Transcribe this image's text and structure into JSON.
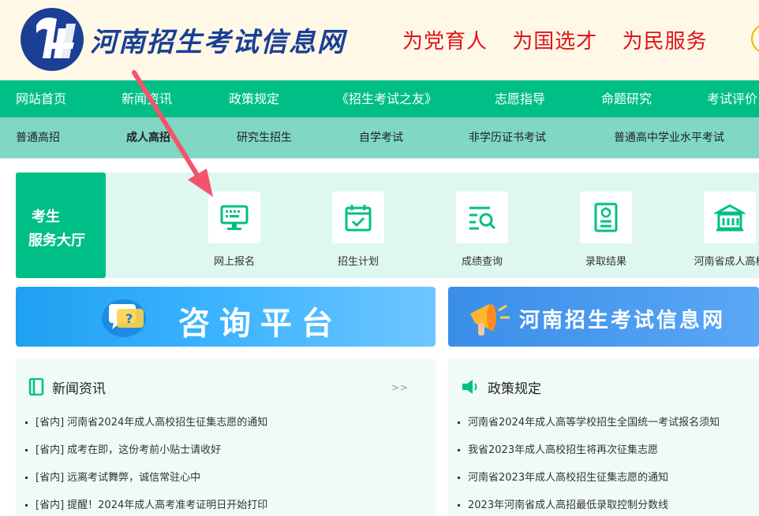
{
  "header": {
    "site_name": "河南招生考试信息网",
    "slogans": [
      "为党育人",
      "为国选才",
      "为民服务"
    ]
  },
  "main_nav": [
    "网站首页",
    "新闻资讯",
    "政策规定",
    "《招生考试之友》",
    "志愿指导",
    "命题研究",
    "考试评价"
  ],
  "sub_nav": [
    "普通高招",
    "成人高招",
    "研究生招生",
    "自学考试",
    "非学历证书考试",
    "普通高中学业水平考试"
  ],
  "sub_nav_active": "成人高招",
  "service_hall": {
    "title_line1": "考生",
    "title_line2": "服务大厅",
    "items": [
      {
        "label": "网上报名",
        "icon": "computer-icon"
      },
      {
        "label": "招生计划",
        "icon": "calendar-check-icon"
      },
      {
        "label": "成绩查询",
        "icon": "search-list-icon"
      },
      {
        "label": "录取结果",
        "icon": "certificate-icon"
      },
      {
        "label": "河南省成人高校",
        "icon": "school-building-icon"
      }
    ]
  },
  "banners": {
    "consult": "咨询平台",
    "site": "河南招生考试信息网"
  },
  "news": {
    "title": "新闻资讯",
    "more": ">>",
    "items": [
      {
        "tag": "[省内]",
        "text": "河南省2024年成人高校招生征集志愿的通知"
      },
      {
        "tag": "[省内]",
        "text": "成考在即，这份考前小贴士请收好"
      },
      {
        "tag": "[省内]",
        "text": "远离考试舞弊，诚信常驻心中"
      },
      {
        "tag": "[省内]",
        "text": "提醒！2024年成人高考准考证明日开始打印"
      }
    ]
  },
  "policy": {
    "title": "政策规定",
    "items": [
      "河南省2024年成人高等学校招生全国统一考试报名须知",
      "我省2023年成人高校招生将再次征集志愿",
      "河南省2023年成人高校招生征集志愿的通知",
      "2023年河南省成人高招最低录取控制分数线"
    ]
  },
  "colors": {
    "brand_green": "#00bf86",
    "sub_nav_green": "#7fd7c4",
    "slogan_red": "#e0131b",
    "logo_blue": "#1a3f95",
    "annotation_arrow": "#f2556b"
  }
}
